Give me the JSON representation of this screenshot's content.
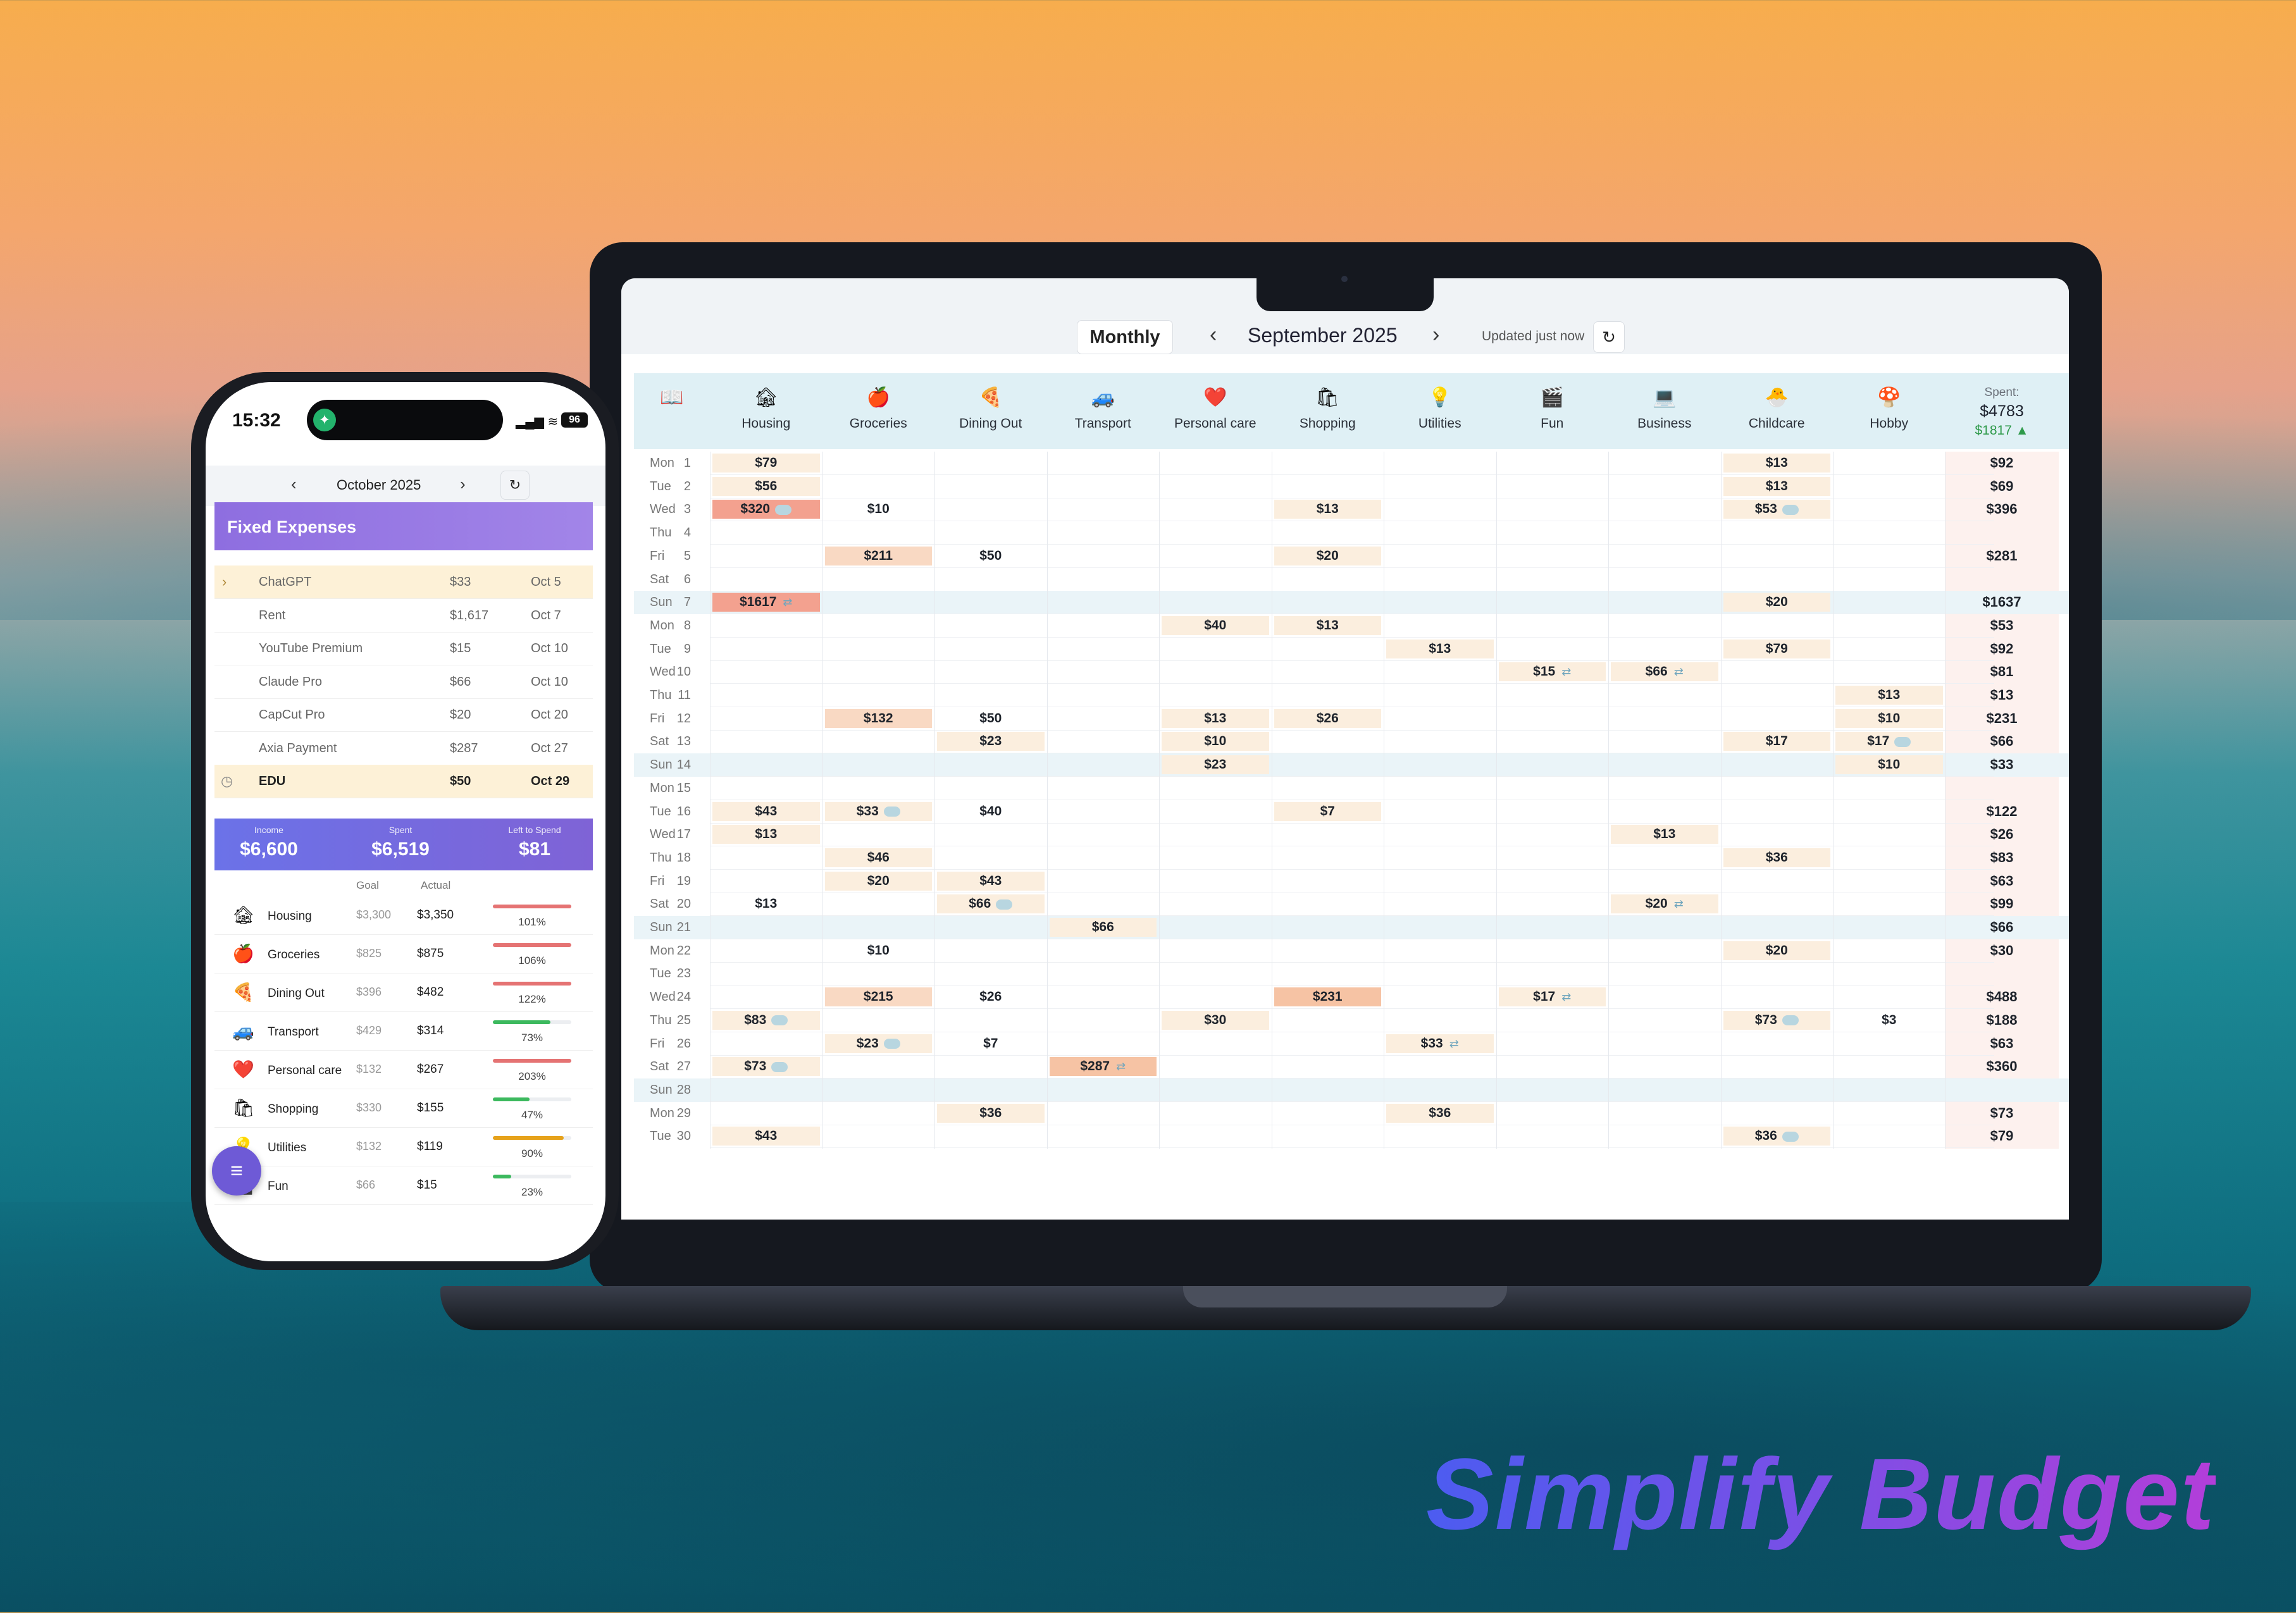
{
  "brand": {
    "title": "Simplify Budget"
  },
  "desktop": {
    "view_mode": "Monthly",
    "month_label": "September 2025",
    "updated": "Updated just now",
    "spent_label": "Spent:",
    "spent_total": "$4783",
    "spent_delta": "$1817 ▲",
    "categories": [
      {
        "label": "Housing",
        "icon": "🏚"
      },
      {
        "label": "Groceries",
        "icon": "🍎"
      },
      {
        "label": "Dining Out",
        "icon": "🍕"
      },
      {
        "label": "Transport",
        "icon": "🚙"
      },
      {
        "label": "Personal care",
        "icon": "❤️"
      },
      {
        "label": "Shopping",
        "icon": "🛍"
      },
      {
        "label": "Utilities",
        "icon": "💡"
      },
      {
        "label": "Fun",
        "icon": "🎬"
      },
      {
        "label": "Business",
        "icon": "💻"
      },
      {
        "label": "Childcare",
        "icon": "🐣"
      },
      {
        "label": "Hobby",
        "icon": "🍄"
      }
    ],
    "days": [
      {
        "dow": "Mon",
        "d": "1",
        "cells": [
          [
            0,
            "$79",
            1,
            ""
          ],
          [
            9,
            "$13",
            1,
            ""
          ]
        ],
        "total": "$92"
      },
      {
        "dow": "Tue",
        "d": "2",
        "cells": [
          [
            0,
            "$56",
            1,
            ""
          ],
          [
            9,
            "$13",
            1,
            ""
          ]
        ],
        "total": "$69"
      },
      {
        "dow": "Wed",
        "d": "3",
        "cells": [
          [
            0,
            "$320",
            4,
            "b"
          ],
          [
            1,
            "$10",
            0,
            ""
          ],
          [
            5,
            "$13",
            1,
            ""
          ],
          [
            9,
            "$53",
            1,
            "b"
          ]
        ],
        "total": "$396"
      },
      {
        "dow": "Thu",
        "d": "4",
        "cells": [],
        "total": ""
      },
      {
        "dow": "Fri",
        "d": "5",
        "cells": [
          [
            1,
            "$211",
            2,
            ""
          ],
          [
            2,
            "$50",
            0,
            ""
          ],
          [
            5,
            "$20",
            1,
            ""
          ]
        ],
        "total": "$281"
      },
      {
        "dow": "Sat",
        "d": "6",
        "cells": [],
        "total": ""
      },
      {
        "dow": "Sun",
        "d": "7",
        "cells": [
          [
            0,
            "$1617",
            4,
            "r"
          ],
          [
            9,
            "$20",
            1,
            ""
          ]
        ],
        "total": "$1637"
      },
      {
        "dow": "Mon",
        "d": "8",
        "cells": [
          [
            4,
            "$40",
            1,
            ""
          ],
          [
            5,
            "$13",
            1,
            ""
          ]
        ],
        "total": "$53"
      },
      {
        "dow": "Tue",
        "d": "9",
        "cells": [
          [
            6,
            "$13",
            1,
            ""
          ],
          [
            9,
            "$79",
            1,
            ""
          ]
        ],
        "total": "$92"
      },
      {
        "dow": "Wed",
        "d": "10",
        "cells": [
          [
            7,
            "$15",
            1,
            "r"
          ],
          [
            8,
            "$66",
            1,
            "r"
          ]
        ],
        "total": "$81"
      },
      {
        "dow": "Thu",
        "d": "11",
        "cells": [
          [
            10,
            "$13",
            1,
            ""
          ]
        ],
        "total": "$13"
      },
      {
        "dow": "Fri",
        "d": "12",
        "cells": [
          [
            1,
            "$132",
            2,
            ""
          ],
          [
            2,
            "$50",
            0,
            ""
          ],
          [
            4,
            "$13",
            1,
            ""
          ],
          [
            5,
            "$26",
            1,
            ""
          ],
          [
            10,
            "$10",
            1,
            ""
          ]
        ],
        "total": "$231"
      },
      {
        "dow": "Sat",
        "d": "13",
        "cells": [
          [
            2,
            "$23",
            1,
            ""
          ],
          [
            4,
            "$10",
            1,
            ""
          ],
          [
            9,
            "$17",
            1,
            ""
          ],
          [
            10,
            "$17",
            1,
            "b"
          ]
        ],
        "total": "$66"
      },
      {
        "dow": "Sun",
        "d": "14",
        "cells": [
          [
            4,
            "$23",
            1,
            ""
          ],
          [
            10,
            "$10",
            1,
            ""
          ]
        ],
        "total": "$33"
      },
      {
        "dow": "Mon",
        "d": "15",
        "cells": [],
        "total": ""
      },
      {
        "dow": "Tue",
        "d": "16",
        "cells": [
          [
            0,
            "$43",
            1,
            ""
          ],
          [
            1,
            "$33",
            1,
            "b"
          ],
          [
            2,
            "$40",
            0,
            ""
          ],
          [
            5,
            "$7",
            1,
            ""
          ]
        ],
        "total": "$122"
      },
      {
        "dow": "Wed",
        "d": "17",
        "cells": [
          [
            0,
            "$13",
            1,
            ""
          ],
          [
            8,
            "$13",
            1,
            ""
          ]
        ],
        "total": "$26"
      },
      {
        "dow": "Thu",
        "d": "18",
        "cells": [
          [
            1,
            "$46",
            1,
            ""
          ],
          [
            9,
            "$36",
            1,
            ""
          ]
        ],
        "total": "$83"
      },
      {
        "dow": "Fri",
        "d": "19",
        "cells": [
          [
            1,
            "$20",
            1,
            ""
          ],
          [
            2,
            "$43",
            1,
            ""
          ]
        ],
        "total": "$63"
      },
      {
        "dow": "Sat",
        "d": "20",
        "cells": [
          [
            0,
            "$13",
            0,
            ""
          ],
          [
            2,
            "$66",
            1,
            "b"
          ],
          [
            8,
            "$20",
            1,
            "r"
          ]
        ],
        "total": "$99"
      },
      {
        "dow": "Sun",
        "d": "21",
        "cells": [
          [
            3,
            "$66",
            1,
            ""
          ]
        ],
        "total": "$66"
      },
      {
        "dow": "Mon",
        "d": "22",
        "cells": [
          [
            1,
            "$10",
            0,
            ""
          ],
          [
            9,
            "$20",
            1,
            ""
          ]
        ],
        "total": "$30"
      },
      {
        "dow": "Tue",
        "d": "23",
        "cells": [],
        "total": ""
      },
      {
        "dow": "Wed",
        "d": "24",
        "cells": [
          [
            1,
            "$215",
            2,
            ""
          ],
          [
            2,
            "$26",
            0,
            ""
          ],
          [
            5,
            "$231",
            3,
            ""
          ],
          [
            7,
            "$17",
            1,
            "r"
          ]
        ],
        "total": "$488"
      },
      {
        "dow": "Thu",
        "d": "25",
        "cells": [
          [
            0,
            "$83",
            1,
            "b"
          ],
          [
            4,
            "$30",
            1,
            ""
          ],
          [
            9,
            "$73",
            1,
            "b"
          ],
          [
            10,
            "$3",
            0,
            ""
          ]
        ],
        "total": "$188"
      },
      {
        "dow": "Fri",
        "d": "26",
        "cells": [
          [
            1,
            "$23",
            1,
            "b"
          ],
          [
            2,
            "$7",
            0,
            ""
          ],
          [
            6,
            "$33",
            1,
            "r"
          ]
        ],
        "total": "$63"
      },
      {
        "dow": "Sat",
        "d": "27",
        "cells": [
          [
            0,
            "$73",
            1,
            "b"
          ],
          [
            3,
            "$287",
            3,
            "r"
          ]
        ],
        "total": "$360"
      },
      {
        "dow": "Sun",
        "d": "28",
        "cells": [],
        "total": ""
      },
      {
        "dow": "Mon",
        "d": "29",
        "cells": [
          [
            2,
            "$36",
            1,
            ""
          ],
          [
            6,
            "$36",
            1,
            ""
          ]
        ],
        "total": "$73"
      },
      {
        "dow": "Tue",
        "d": "30",
        "cells": [
          [
            0,
            "$43",
            1,
            ""
          ],
          [
            9,
            "$36",
            1,
            "b"
          ]
        ],
        "total": "$79"
      }
    ]
  },
  "phone": {
    "time": "15:32",
    "battery": "96",
    "month_label": "October 2025",
    "fixed_title": "Fixed Expenses",
    "fixed": [
      {
        "name": "ChatGPT",
        "amount": "$33",
        "date": "Oct 5"
      },
      {
        "name": "Rent",
        "amount": "$1,617",
        "date": "Oct 7"
      },
      {
        "name": "YouTube Premium",
        "amount": "$15",
        "date": "Oct 10"
      },
      {
        "name": "Claude Pro",
        "amount": "$66",
        "date": "Oct 10"
      },
      {
        "name": "CapCut Pro",
        "amount": "$20",
        "date": "Oct 20"
      },
      {
        "name": "Axia Payment",
        "amount": "$287",
        "date": "Oct 27"
      },
      {
        "name": "EDU",
        "amount": "$50",
        "date": "Oct 29"
      }
    ],
    "income_label": "Income",
    "income": "$6,600",
    "spent_label": "Spent",
    "spent": "$6,519",
    "left_label": "Left to Spend",
    "left": "$81",
    "goal_col": "Goal",
    "actual_col": "Actual",
    "cats": [
      {
        "icon": "🏚",
        "name": "Housing",
        "goal": "$3,300",
        "actual": "$3,350",
        "pct": "101%",
        "fill": 1.0,
        "color": "#e57373"
      },
      {
        "icon": "🍎",
        "name": "Groceries",
        "goal": "$825",
        "actual": "$875",
        "pct": "106%",
        "fill": 1.0,
        "color": "#e57373"
      },
      {
        "icon": "🍕",
        "name": "Dining Out",
        "goal": "$396",
        "actual": "$482",
        "pct": "122%",
        "fill": 1.0,
        "color": "#e57373"
      },
      {
        "icon": "🚙",
        "name": "Transport",
        "goal": "$429",
        "actual": "$314",
        "pct": "73%",
        "fill": 0.73,
        "color": "#3cb95e"
      },
      {
        "icon": "❤️",
        "name": "Personal care",
        "goal": "$132",
        "actual": "$267",
        "pct": "203%",
        "fill": 1.0,
        "color": "#e57373"
      },
      {
        "icon": "🛍",
        "name": "Shopping",
        "goal": "$330",
        "actual": "$155",
        "pct": "47%",
        "fill": 0.47,
        "color": "#3cb95e"
      },
      {
        "icon": "💡",
        "name": "Utilities",
        "goal": "$132",
        "actual": "$119",
        "pct": "90%",
        "fill": 0.9,
        "color": "#e6a21b"
      },
      {
        "icon": "🎬",
        "name": "Fun",
        "goal": "$66",
        "actual": "$15",
        "pct": "23%",
        "fill": 0.23,
        "color": "#3cb95e"
      }
    ]
  }
}
